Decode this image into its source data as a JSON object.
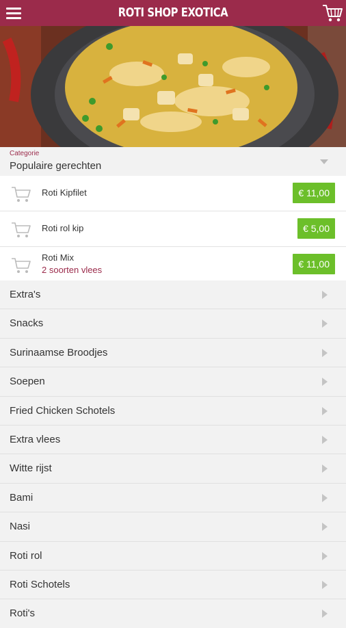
{
  "header": {
    "brand": "ROTI SHOP EXOTICA",
    "menu_icon": "hamburger-icon",
    "cart_icon": "cart-icon",
    "color": "#9b2b4b"
  },
  "category_select": {
    "label": "Categorie",
    "value": "Populaire gerechten"
  },
  "popular_items": [
    {
      "name": "Roti Kipfilet",
      "subtitle": "",
      "price": "€ 11,00"
    },
    {
      "name": "Roti rol kip",
      "subtitle": "",
      "price": "€ 5,00"
    },
    {
      "name": "Roti Mix",
      "subtitle": "2 soorten vlees",
      "price": "€ 11,00"
    }
  ],
  "categories": [
    "Extra's",
    "Snacks",
    "Surinaamse Broodjes",
    "Soepen",
    "Fried Chicken Schotels",
    "Extra vlees",
    "Witte rijst",
    "Bami",
    "Nasi",
    "Roti rol",
    "Roti Schotels",
    "Roti's"
  ],
  "colors": {
    "accent": "#9b2b4b",
    "price": "#6cbf2a"
  }
}
